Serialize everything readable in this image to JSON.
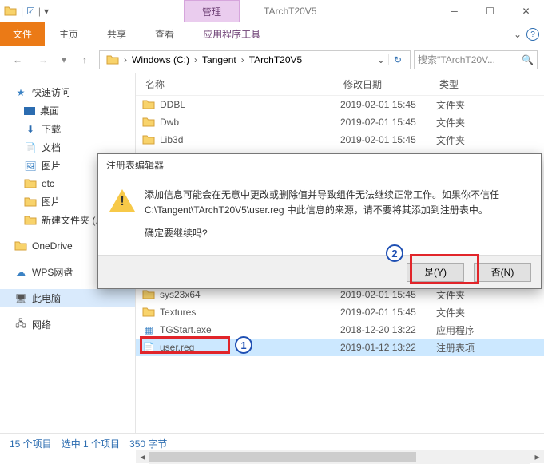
{
  "window": {
    "title": "TArchT20V5",
    "manage_tab": "管理",
    "tool_tab": "应用程序工具"
  },
  "tabs": {
    "file": "文件",
    "home": "主页",
    "share": "共享",
    "view": "查看"
  },
  "nav": {
    "crumbs": [
      "Windows (C:)",
      "Tangent",
      "TArchT20V5"
    ],
    "search_placeholder": "搜索\"TArchT20V..."
  },
  "sidebar": {
    "quick": "快速访问",
    "items": [
      "桌面",
      "下载",
      "文档",
      "图片",
      "etc",
      "图片",
      "新建文件夹 (..."
    ],
    "onedrive": "OneDrive",
    "wps": "WPS网盘",
    "thispc": "此电脑",
    "network": "网络"
  },
  "columns": {
    "name": "名称",
    "date": "修改日期",
    "type": "类型"
  },
  "files": [
    {
      "name": "DDBL",
      "date": "2019-02-01 15:45",
      "type": "文件夹",
      "kind": "folder"
    },
    {
      "name": "Dwb",
      "date": "2019-02-01 15:45",
      "type": "文件夹",
      "kind": "folder"
    },
    {
      "name": "Lib3d",
      "date": "2019-02-01 15:45",
      "type": "文件夹",
      "kind": "folder"
    },
    {
      "name": "sys23x64",
      "date": "2019-02-01 15:45",
      "type": "文件夹",
      "kind": "folder"
    },
    {
      "name": "Textures",
      "date": "2019-02-01 15:45",
      "type": "文件夹",
      "kind": "folder"
    },
    {
      "name": "TGStart.exe",
      "date": "2018-12-20 13:22",
      "type": "应用程序",
      "kind": "exe"
    },
    {
      "name": "user.reg",
      "date": "2019-01-12 13:22",
      "type": "注册表项",
      "kind": "reg",
      "selected": true
    }
  ],
  "dialog": {
    "title": "注册表编辑器",
    "line1": "添加信息可能会在无意中更改或删除值并导致组件无法继续正常工作。如果你不信任 C:\\Tangent\\TArchT20V5\\user.reg 中此信息的来源，请不要将其添加到注册表中。",
    "line2": "确定要继续吗?",
    "yes": "是(Y)",
    "no": "否(N)"
  },
  "status": {
    "count": "15 个项目",
    "selected": "选中 1 个项目",
    "size": "350 字节"
  },
  "annotations": {
    "badge1": "1",
    "badge2": "2"
  }
}
